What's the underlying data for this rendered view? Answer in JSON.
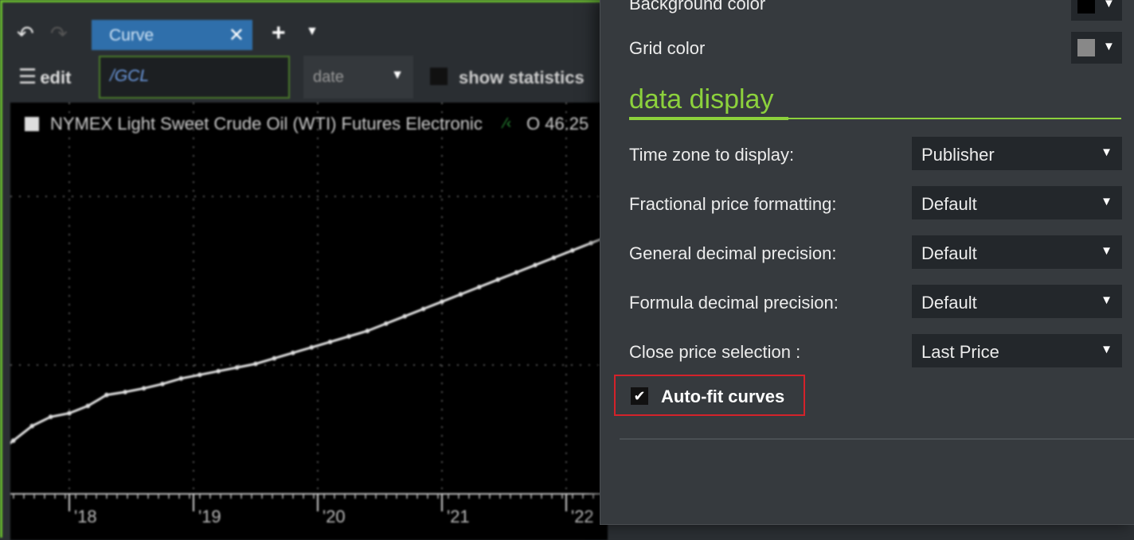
{
  "tabbar": {
    "back_icon": "↶",
    "forward_icon": "↷",
    "tab_label": "Curve",
    "tab_close": "✕",
    "plus_icon": "+",
    "plus_caret": "▼"
  },
  "toolbar": {
    "edit_icon": "☰",
    "edit_label": "edit",
    "symbol_value": "/GCL",
    "date_value": "date",
    "date_caret": "▼",
    "show_statistics_label": "show statistics"
  },
  "chart": {
    "legend_text": "NYMEX Light Sweet Crude Oil (WTI) Futures Electronic",
    "legend_green": "⁄‹",
    "legend_open": "O 46.25"
  },
  "chart_data": {
    "type": "line",
    "x_tick_labels": [
      "'18",
      "'19",
      "'20",
      "'21",
      "'22"
    ],
    "x": [
      2017.05,
      2017.25,
      2017.4,
      2017.55,
      2017.7,
      2017.85,
      2018.0,
      2018.15,
      2018.3,
      2018.45,
      2018.6,
      2018.75,
      2018.9,
      2019.05,
      2019.2,
      2019.35,
      2019.5,
      2019.65,
      2019.8,
      2019.95,
      2020.1,
      2020.25,
      2020.4,
      2020.55,
      2020.7,
      2020.85,
      2021.0,
      2021.15,
      2021.3,
      2021.45,
      2021.6,
      2021.75,
      2021.9,
      2022.05,
      2022.2,
      2022.35
    ],
    "values": [
      0.5,
      3.5,
      7.5,
      11.5,
      15.5,
      18.0,
      19.0,
      21.0,
      24.0,
      24.8,
      25.8,
      27.0,
      28.5,
      29.5,
      30.5,
      31.5,
      32.5,
      34.0,
      35.5,
      37.0,
      38.5,
      40.0,
      41.5,
      43.5,
      45.5,
      47.5,
      49.5,
      51.5,
      53.5,
      55.5,
      57.5,
      59.5,
      61.5,
      63.5,
      65.5,
      67.5
    ],
    "grid": true,
    "background": "#000000",
    "line_color": "#e0e0e0",
    "grid_color": "#777777"
  },
  "settings": {
    "background_color_label": "Background color",
    "background_color_value": "#000000",
    "grid_color_label": "Grid color",
    "grid_color_value": "#888888",
    "swatch_caret": "▼",
    "section_title": "data display",
    "rows": [
      {
        "label": "Time zone to display:",
        "value": "Publisher"
      },
      {
        "label": "Fractional price formatting:",
        "value": "Default"
      },
      {
        "label": "General decimal precision:",
        "value": "Default"
      },
      {
        "label": "Formula decimal precision:",
        "value": "Default"
      },
      {
        "label": "Close price selection :",
        "value": "Last Price"
      }
    ],
    "dropdown_caret": "▼",
    "autofit_label": "Auto-fit curves",
    "autofit_checked": true,
    "autofit_check_glyph": "✔",
    "accent_color": "#8cd13c",
    "highlight_color": "#d4222a"
  }
}
